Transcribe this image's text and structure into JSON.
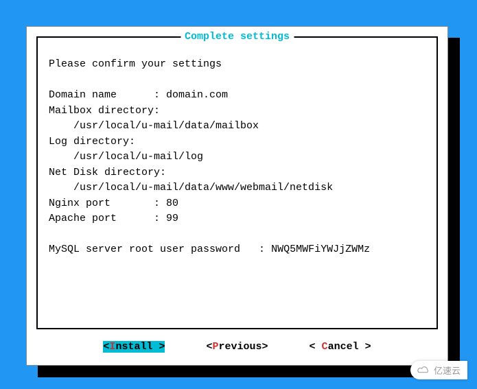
{
  "dialog": {
    "title": "Complete settings",
    "confirm_line": "Please confirm your settings",
    "domain_label": "Domain name      : ",
    "domain_value": "domain.com",
    "mailbox_dir_label": "Mailbox directory:",
    "mailbox_dir_value": "    /usr/local/u-mail/data/mailbox",
    "log_dir_label": "Log directory:",
    "log_dir_value": "    /usr/local/u-mail/log",
    "netdisk_dir_label": "Net Disk directory:",
    "netdisk_dir_value": "    /usr/local/u-mail/data/www/webmail/netdisk",
    "nginx_port_label": "Nginx port       : ",
    "nginx_port_value": "80",
    "apache_port_label": "Apache port      : ",
    "apache_port_value": "99",
    "mysql_pwd_label": "MySQL server root user password   : ",
    "mysql_pwd_value": "NWQ5MWFiYWJjZWMz"
  },
  "buttons": {
    "install_fl": "I",
    "install_rest": "nstall ",
    "previous_fl": "P",
    "previous_rest": "revious",
    "cancel_fl": "C",
    "cancel_rest": "ancel "
  },
  "watermark": "亿速云"
}
